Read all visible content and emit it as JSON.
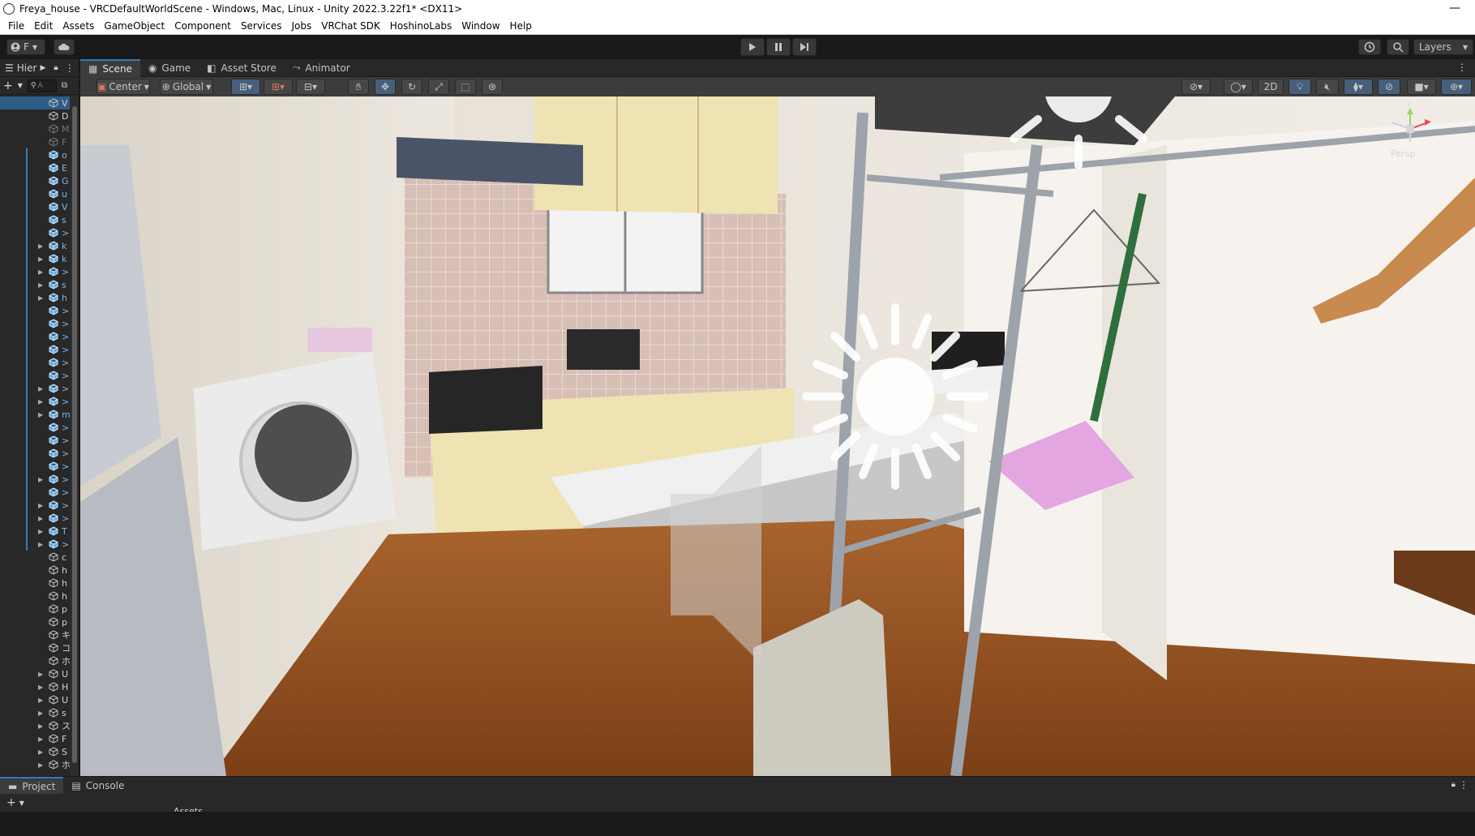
{
  "window": {
    "title": "Freya_house - VRCDefaultWorldScene - Windows, Mac, Linux - Unity 2022.3.22f1* <DX11>",
    "minimize": "—"
  },
  "menu": [
    "File",
    "Edit",
    "Assets",
    "GameObject",
    "Component",
    "Services",
    "Jobs",
    "VRChat SDK",
    "HoshinoLabs",
    "Window",
    "Help"
  ],
  "toolbar": {
    "account_label": "F",
    "layers_label": "Layers"
  },
  "hierarchy": {
    "tab_label": "Hier",
    "search_placeholder": "A",
    "rows": [
      {
        "name": "V"
      },
      {
        "name": "D"
      },
      {
        "name": "M"
      },
      {
        "name": "F"
      },
      {
        "name": "o"
      },
      {
        "name": "E"
      },
      {
        "name": "G"
      },
      {
        "name": "u"
      },
      {
        "name": "V"
      },
      {
        "name": "s"
      },
      {
        "name": ">"
      },
      {
        "name": "k"
      },
      {
        "name": "k"
      },
      {
        "name": ">"
      },
      {
        "name": "s"
      },
      {
        "name": "h"
      },
      {
        "name": ">"
      },
      {
        "name": ">"
      },
      {
        "name": ">"
      },
      {
        "name": ">"
      },
      {
        "name": ">"
      },
      {
        "name": ">"
      },
      {
        "name": ">"
      },
      {
        "name": ">"
      },
      {
        "name": "m"
      },
      {
        "name": ">"
      },
      {
        "name": ">"
      },
      {
        "name": ">"
      },
      {
        "name": ">"
      },
      {
        "name": ">"
      },
      {
        "name": ">"
      },
      {
        "name": ">"
      },
      {
        "name": ">"
      },
      {
        "name": "T"
      },
      {
        "name": ">"
      },
      {
        "name": "c"
      },
      {
        "name": "h"
      },
      {
        "name": "h"
      },
      {
        "name": "h"
      },
      {
        "name": "p"
      },
      {
        "name": "p"
      },
      {
        "name": "キ"
      },
      {
        "name": "コ"
      },
      {
        "name": "ホ"
      },
      {
        "name": "U"
      },
      {
        "name": "H"
      },
      {
        "name": "U"
      },
      {
        "name": "s"
      },
      {
        "name": "ス"
      },
      {
        "name": "F"
      },
      {
        "name": "S"
      },
      {
        "name": "ホ"
      }
    ]
  },
  "scene": {
    "tabs": [
      "Scene",
      "Game",
      "Asset Store",
      "Animator"
    ],
    "pivot_label": "Center",
    "space_label": "Global",
    "mode_2d_label": "2D",
    "persp_label": "Persp"
  },
  "bottom": {
    "tabs": [
      "Project",
      "Console"
    ],
    "assets_label": "Assets"
  },
  "colors": {
    "accent": "#3a79bb",
    "selected_row": "#2c5d87",
    "editor_bg": "#282828"
  }
}
